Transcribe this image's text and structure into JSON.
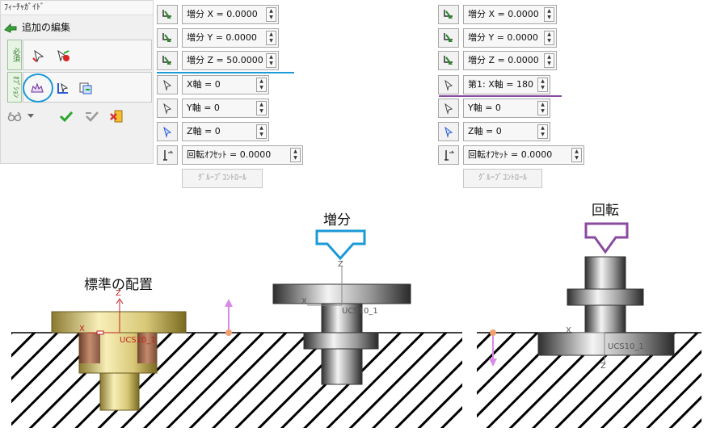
{
  "guide": {
    "title": "ﾌｨｰﾁｬｶﾞｲﾄﾞ",
    "add_edit": "追加の編集",
    "tab_required": "必須",
    "tab_option": "ｵﾌﾟｼｮﾝ"
  },
  "panel_increment": {
    "inc_x": "増分 X = 0.0000",
    "inc_y": "増分 Y = 0.0000",
    "inc_z": "増分 Z = 50.0000",
    "x_axis": "X軸 = 0",
    "y_axis": "Y軸 = 0",
    "z_axis": "Z軸 = 0",
    "rot_offset": "回転ｵﾌｾｯﾄ = 0.0000",
    "group_control": "ｸﾞﾙｰﾌﾟｺﾝﾄﾛｰﾙ"
  },
  "panel_rotation": {
    "inc_x": "増分 X = 0.0000",
    "inc_y": "増分 Y = 0.0000",
    "inc_z": "増分 Z = 0.0000",
    "x_axis": "第1: X軸 = 180",
    "y_axis": "Y軸 = 0",
    "z_axis": "Z軸 = 0",
    "rot_offset": "回転ｵﾌｾｯﾄ = 0.0000",
    "group_control": "ｸﾞﾙｰﾌﾟｺﾝﾄﾛｰﾙ"
  },
  "scenes": {
    "standard_label": "標準の配置",
    "increment_label": "増分",
    "rotation_label": "回転",
    "axis_z": "Z",
    "axis_x": "X",
    "ucs": "UCS10_1"
  },
  "colors": {
    "highlight_blue": "#1a9ad6",
    "highlight_purple": "#8a4aa0",
    "pink_arrow": "#d88ae6",
    "orange_dot": "#f0a070",
    "check_green": "#2aa82a"
  }
}
